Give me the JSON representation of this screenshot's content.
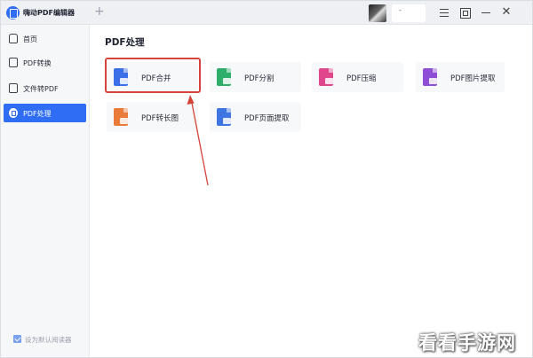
{
  "window": {
    "app_title": "嗨动PDF编辑器",
    "new_tab": "+",
    "user_name": "-",
    "close_glyph": "✕"
  },
  "sidebar": {
    "items": [
      {
        "label": "首页",
        "icon": "home-icon"
      },
      {
        "label": "PDF转换",
        "icon": "convert-icon"
      },
      {
        "label": "文件转PDF",
        "icon": "file-to-pdf-icon"
      },
      {
        "label": "PDF处理",
        "icon": "pdf-process-icon",
        "active": true
      }
    ],
    "footer": {
      "label": "设为默认阅读器",
      "checked": true
    }
  },
  "main": {
    "section_title": "PDF处理",
    "tools": [
      {
        "label": "PDF合并",
        "color": "#3b6fe8"
      },
      {
        "label": "PDF分割",
        "color": "#2fae6a"
      },
      {
        "label": "PDF压缩",
        "color": "#e0468c"
      },
      {
        "label": "PDF图片提取",
        "color": "#8e4fd6"
      },
      {
        "label": "PDF转长图",
        "color": "#ea7a3a"
      },
      {
        "label": "PDF页面提取",
        "color": "#3f74e3"
      }
    ]
  },
  "annotation": {
    "highlight_color": "#d6433b"
  },
  "watermark": "看看手游网"
}
